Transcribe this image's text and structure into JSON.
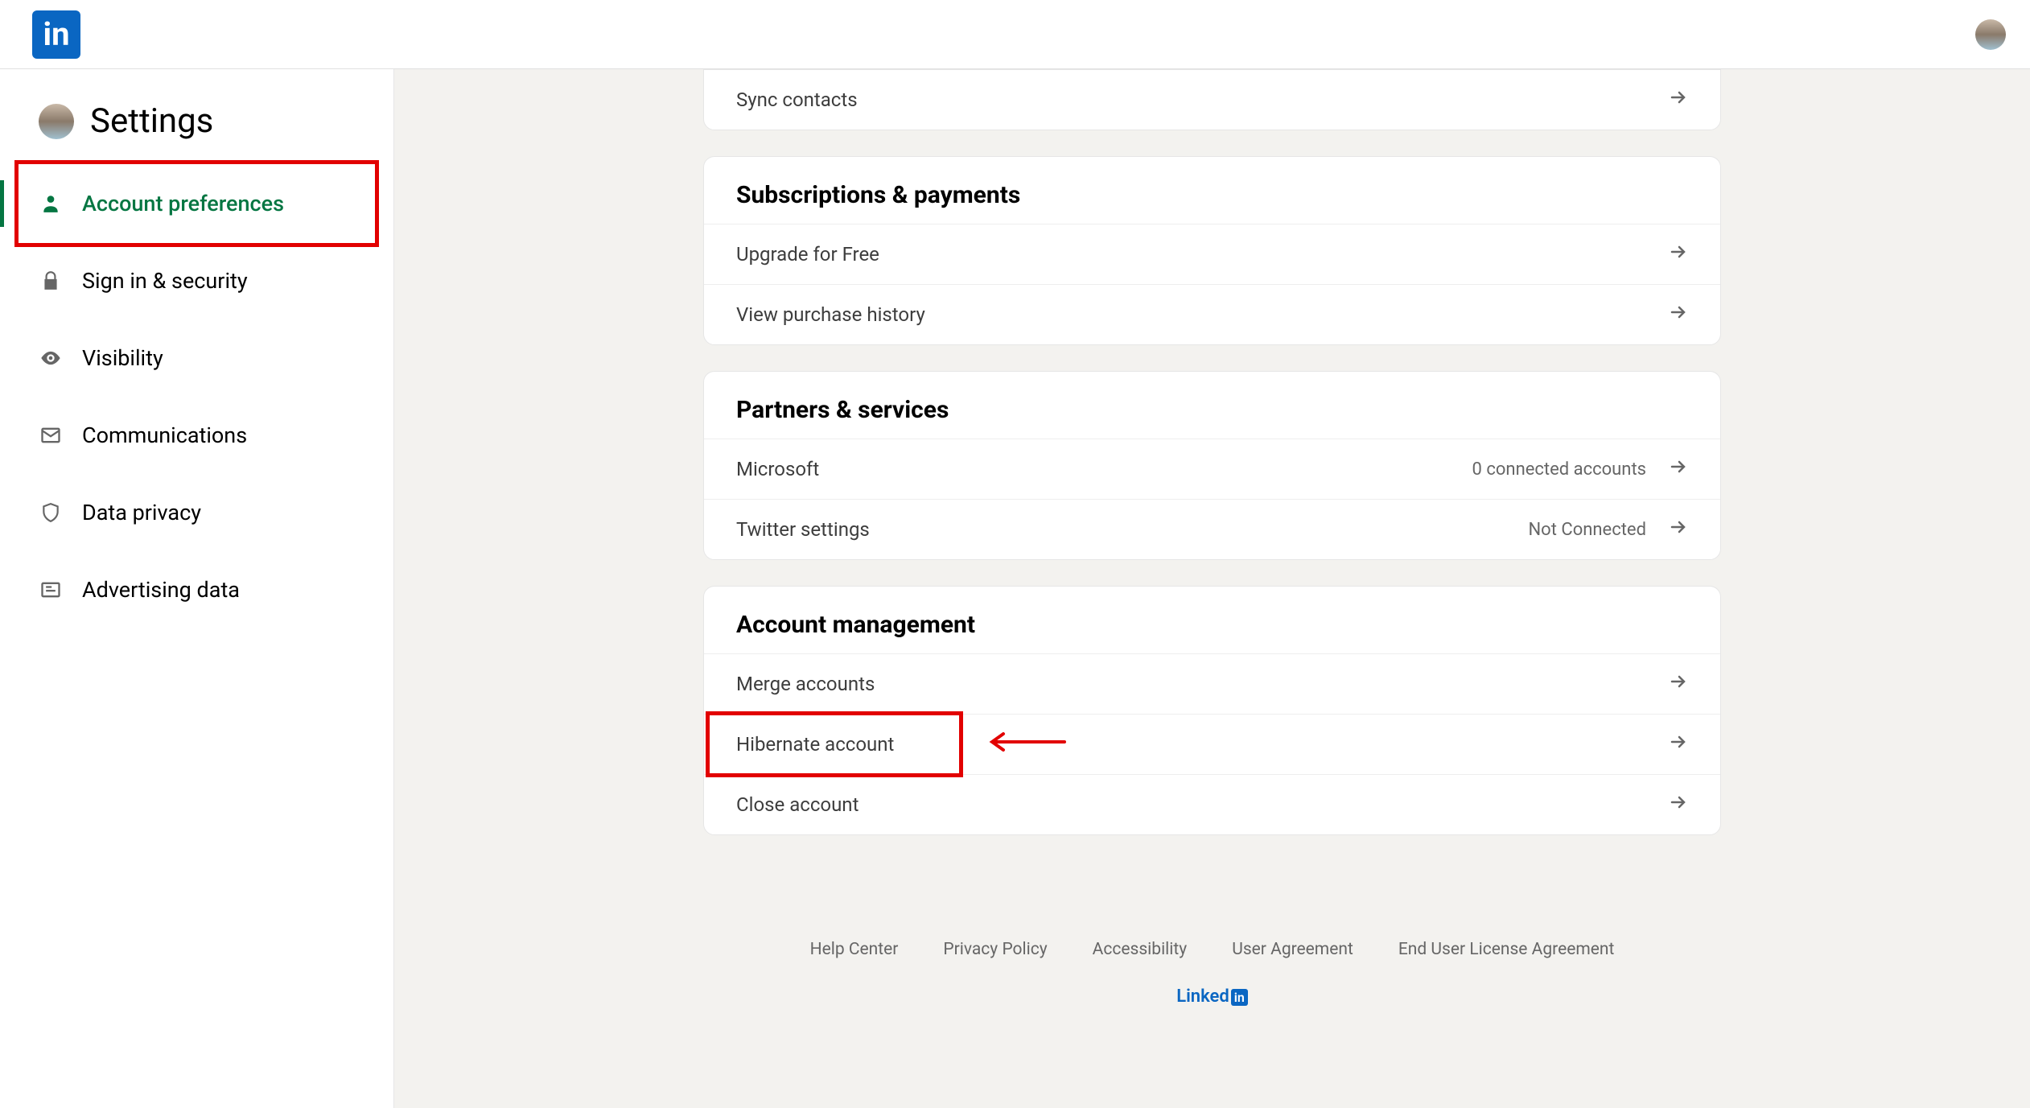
{
  "header": {
    "logo_text": "in"
  },
  "sidebar": {
    "title": "Settings",
    "items": [
      {
        "label": "Account preferences",
        "icon": "user"
      },
      {
        "label": "Sign in & security",
        "icon": "lock"
      },
      {
        "label": "Visibility",
        "icon": "eye"
      },
      {
        "label": "Communications",
        "icon": "mail"
      },
      {
        "label": "Data privacy",
        "icon": "shield"
      },
      {
        "label": "Advertising data",
        "icon": "newspaper"
      }
    ]
  },
  "sections": {
    "sync_contacts": "Sync contacts",
    "subscriptions": {
      "title": "Subscriptions & payments",
      "rows": [
        {
          "label": "Upgrade for Free",
          "status": ""
        },
        {
          "label": "View purchase history",
          "status": ""
        }
      ]
    },
    "partners": {
      "title": "Partners & services",
      "rows": [
        {
          "label": "Microsoft",
          "status": "0 connected accounts"
        },
        {
          "label": "Twitter settings",
          "status": "Not Connected"
        }
      ]
    },
    "account_mgmt": {
      "title": "Account management",
      "rows": [
        {
          "label": "Merge accounts",
          "status": ""
        },
        {
          "label": "Hibernate account",
          "status": ""
        },
        {
          "label": "Close account",
          "status": ""
        }
      ]
    }
  },
  "footer": {
    "links": [
      "Help Center",
      "Privacy Policy",
      "Accessibility",
      "User Agreement",
      "End User License Agreement"
    ],
    "brand": "Linked"
  },
  "annotations": {
    "highlight_color": "#e20000"
  }
}
